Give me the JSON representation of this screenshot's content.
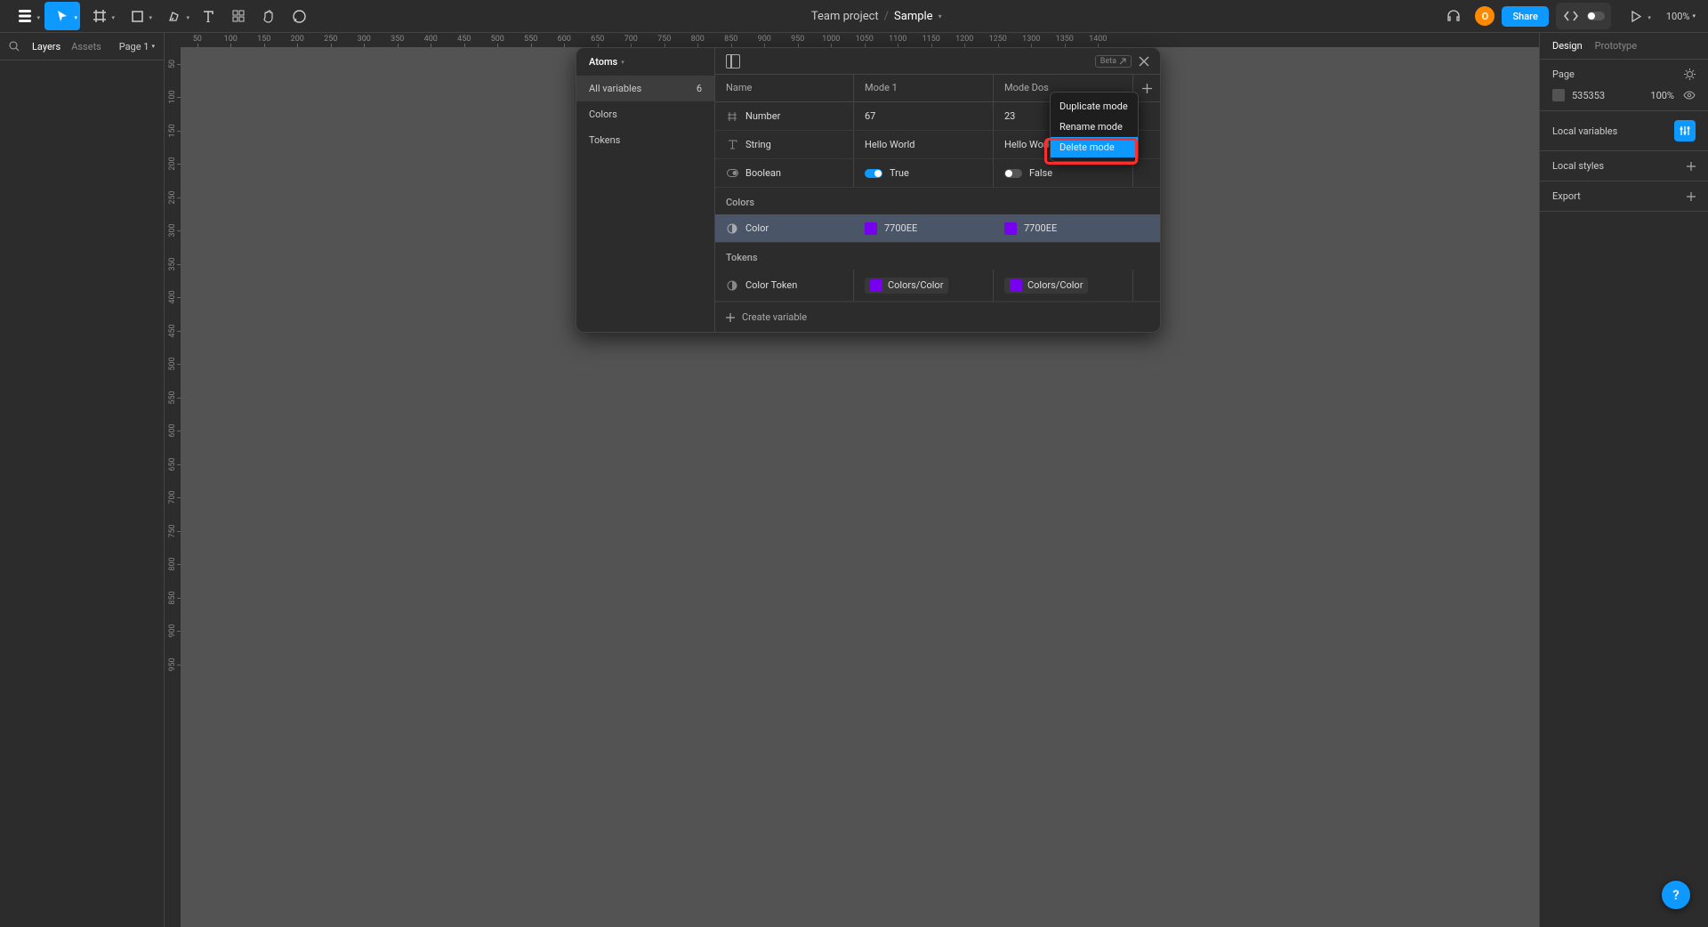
{
  "toolbar": {
    "project": "Team project",
    "separator": "/",
    "file": "Sample",
    "share_label": "Share",
    "zoom": "100%"
  },
  "avatar_letter": "O",
  "left_panel": {
    "tab_layers": "Layers",
    "tab_assets": "Assets",
    "page_label": "Page 1"
  },
  "ruler_h": [
    "50",
    "100",
    "150",
    "200",
    "250",
    "300",
    "350",
    "400",
    "450",
    "500",
    "550",
    "600",
    "650",
    "700",
    "750",
    "800",
    "850",
    "900",
    "950",
    "1000",
    "1050",
    "1100",
    "1150",
    "1200",
    "1250",
    "1300",
    "1350",
    "1400"
  ],
  "ruler_v": [
    "50",
    "100",
    "150",
    "200",
    "250",
    "300",
    "350",
    "400",
    "450",
    "500",
    "550",
    "600",
    "650",
    "700",
    "750",
    "800",
    "850",
    "900",
    "950"
  ],
  "variables_panel": {
    "collection_name": "Atoms",
    "sidebar": {
      "all_label": "All variables",
      "all_count": "6",
      "group_colors": "Colors",
      "group_tokens": "Tokens"
    },
    "beta_label": "Beta",
    "columns": {
      "name": "Name",
      "mode1": "Mode 1",
      "mode2": "Mode Dos"
    },
    "rows": {
      "number": {
        "label": "Number",
        "v1": "67",
        "v2": "23"
      },
      "string": {
        "label": "String",
        "v1": "Hello World",
        "v2": "Hello World"
      },
      "boolean": {
        "label": "Boolean",
        "v1_label": "True",
        "v2_label": "False"
      },
      "group_colors_label": "Colors",
      "color": {
        "label": "Color",
        "v1": "7700EE",
        "v2": "7700EE",
        "swatch": "#7700EE"
      },
      "group_tokens_label": "Tokens",
      "color_token": {
        "label": "Color Token",
        "v1": "Colors/Color",
        "v2": "Colors/Color",
        "swatch": "#7700EE"
      }
    },
    "create_label": "Create variable"
  },
  "context_menu": {
    "duplicate": "Duplicate mode",
    "rename": "Rename mode",
    "delete": "Delete mode"
  },
  "right_panel": {
    "tab_design": "Design",
    "tab_prototype": "Prototype",
    "page_label": "Page",
    "bg_value": "535353",
    "bg_opacity": "100%",
    "local_variables": "Local variables",
    "local_styles": "Local styles",
    "export": "Export"
  },
  "help_label": "?"
}
